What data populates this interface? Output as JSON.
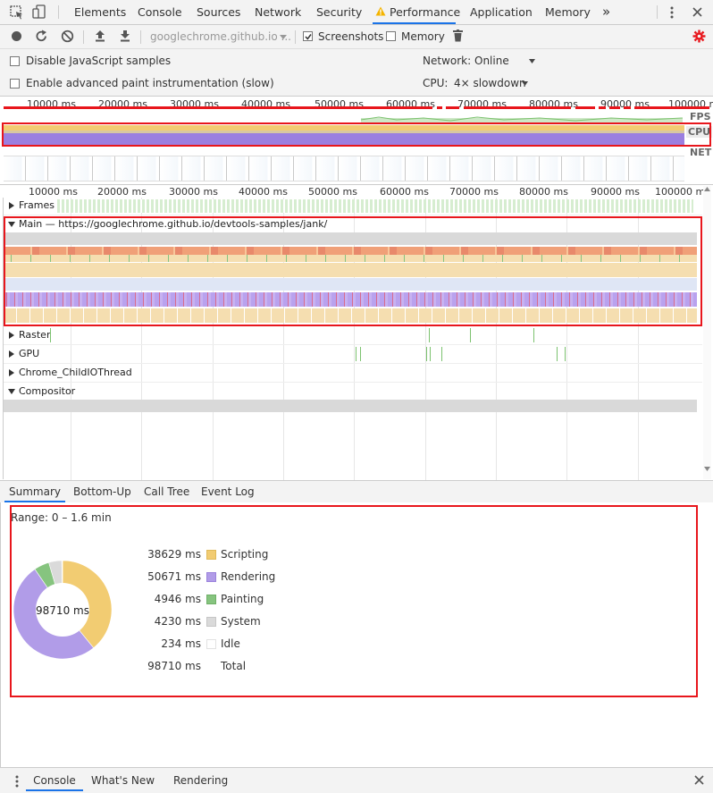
{
  "tabs": {
    "items": [
      "Elements",
      "Console",
      "Sources",
      "Network",
      "Security",
      "Performance",
      "Application",
      "Memory"
    ],
    "more": "»"
  },
  "toolbar": {
    "url": "googlechrome.github.io ...",
    "screenshots_label": "Screenshots",
    "screenshots_checked": true,
    "memory_label": "Memory",
    "memory_checked": false
  },
  "settings": {
    "disable_js_label": "Disable JavaScript samples",
    "advanced_paint_label": "Enable advanced paint instrumentation (slow)",
    "network_label": "Network:",
    "network_value": "Online",
    "cpu_label": "CPU:",
    "cpu_value": "4× slowdown"
  },
  "overview": {
    "ticks": [
      "10000 ms",
      "20000 ms",
      "30000 ms",
      "40000 ms",
      "50000 ms",
      "60000 ms",
      "70000 ms",
      "80000 ms",
      "90000 ms",
      "100000 r"
    ],
    "fps_label": "FPS",
    "cpu_label": "CPU",
    "net_label": "NET"
  },
  "timeline": {
    "ticks": [
      "10000 ms",
      "20000 ms",
      "30000 ms",
      "40000 ms",
      "50000 ms",
      "60000 ms",
      "70000 ms",
      "80000 ms",
      "90000 ms",
      "100000 m"
    ],
    "frames_label": "Frames",
    "main_label": "Main — https://googlechrome.github.io/devtools-samples/jank/",
    "raster_label": "Raster",
    "gpu_label": "GPU",
    "io_label": "Chrome_ChildIOThread",
    "compositor_label": "Compositor"
  },
  "bottom_tabs": [
    "Summary",
    "Bottom-Up",
    "Call Tree",
    "Event Log"
  ],
  "summary": {
    "range": "Range: 0 – 1.6 min",
    "center_label": "98710 ms",
    "rows": [
      {
        "value": "38629 ms",
        "name": "Scripting",
        "color": "#f2cc72"
      },
      {
        "value": "50671 ms",
        "name": "Rendering",
        "color": "#b19ce8"
      },
      {
        "value": "4946 ms",
        "name": "Painting",
        "color": "#86c47f"
      },
      {
        "value": "4230 ms",
        "name": "System",
        "color": "#dadada"
      },
      {
        "value": "234 ms",
        "name": "Idle",
        "color": "#ffffff"
      },
      {
        "value": "98710 ms",
        "name": "Total",
        "color": ""
      }
    ]
  },
  "drawer": {
    "tabs": [
      "Console",
      "What's New",
      "Rendering"
    ]
  }
}
